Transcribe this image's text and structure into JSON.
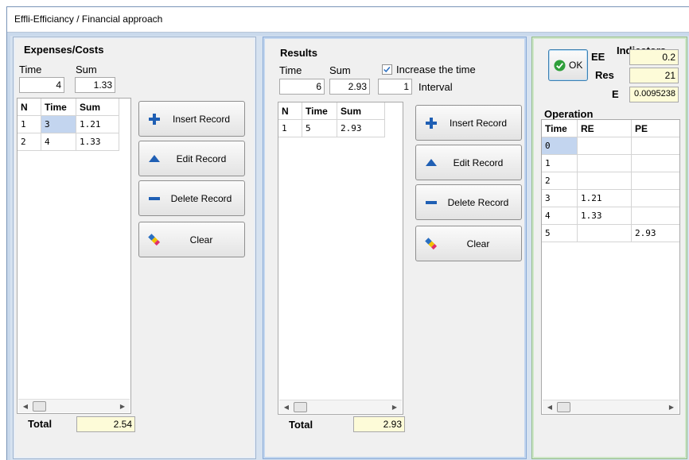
{
  "window": {
    "title": "Effli-Efficiancy / Financial approach"
  },
  "expenses": {
    "heading": "Expenses/Costs",
    "time_label": "Time",
    "sum_label": "Sum",
    "time_value": "4",
    "sum_value": "1.33",
    "columns": [
      "N",
      "Time",
      "Sum"
    ],
    "rows": [
      [
        "1",
        "3",
        "1.21"
      ],
      [
        "2",
        "4",
        "1.33"
      ]
    ],
    "total_label": "Total",
    "total_value": "2.54"
  },
  "results": {
    "heading": "Results",
    "time_label": "Time",
    "sum_label": "Sum",
    "time_value": "6",
    "sum_value": "2.93",
    "interval_value": "1",
    "interval_label": "Interval",
    "increase_label": "Increase the time",
    "increase_checked": true,
    "columns": [
      "N",
      "Time",
      "Sum"
    ],
    "rows": [
      [
        "1",
        "5",
        "2.93"
      ]
    ],
    "total_label": "Total",
    "total_value": "2.93"
  },
  "buttons": {
    "insert": "Insert Record",
    "edit": "Edit Record",
    "delete": "Delete Record",
    "clear": "Clear",
    "ok": "OK"
  },
  "icons": {
    "insert": "plus-icon",
    "edit": "triangle-up-icon",
    "delete": "minus-icon",
    "clear": "eraser-icon",
    "ok": "check-circle-icon"
  },
  "indicators": {
    "heading": "Indicators",
    "ee_label": "EE",
    "ee_value": "0.2",
    "res_label": "Res",
    "res_value": "21",
    "e_label": "E",
    "e_value": "0.0095238"
  },
  "operation": {
    "heading": "Operation",
    "columns": [
      "Time",
      "RE",
      "PE"
    ],
    "rows": [
      [
        "0",
        "",
        ""
      ],
      [
        "1",
        "",
        ""
      ],
      [
        "2",
        "",
        ""
      ],
      [
        "3",
        "1.21",
        ""
      ],
      [
        "4",
        "1.33",
        ""
      ],
      [
        "5",
        "",
        "2.93"
      ]
    ]
  },
  "colors": {
    "accent_blue": "#2a6fc1",
    "plus_blue": "#1f5fb4",
    "ok_green": "#2e9e3a",
    "selection": "#c3d5ef",
    "total_yellow": "#fdfbd8"
  }
}
